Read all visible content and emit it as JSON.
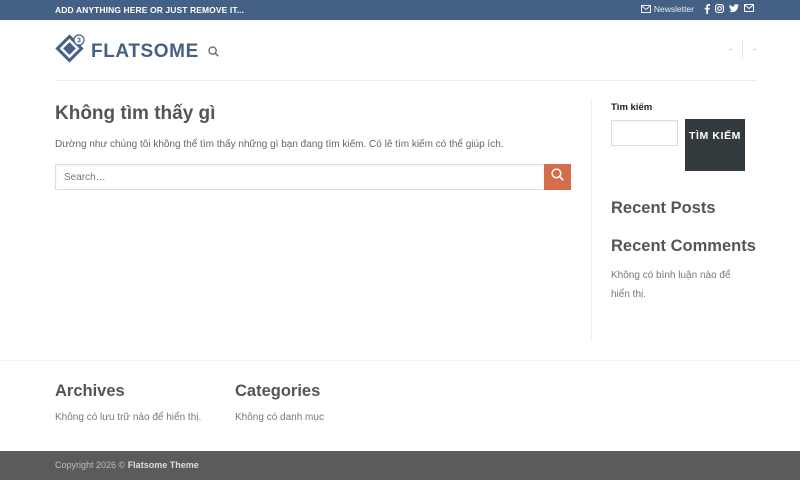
{
  "topbar": {
    "promo": "ADD ANYTHING HERE OR JUST REMOVE IT...",
    "newsletter_label": "Newsletter",
    "newsletter_icon": "envelope-icon",
    "social_icons": [
      "facebook-icon",
      "instagram-icon",
      "twitter-icon",
      "email-icon"
    ]
  },
  "header": {
    "logo_text": "FLATSOME",
    "logo_badge": "3",
    "search_icon": "search-icon",
    "nav_items": [
      "-",
      "-"
    ]
  },
  "main": {
    "title": "Không tìm thấy gì",
    "message": "Dường như chúng tôi không thể tìm thấy những gì bạn đang tìm kiếm. Có lẽ tìm kiếm có thể giúp ích.",
    "search": {
      "placeholder": "Search…",
      "value": "",
      "button_icon": "search-icon"
    }
  },
  "sidebar": {
    "search_label": "Tìm kiếm",
    "search_value": "",
    "search_button": "TÌM KIẾM",
    "recent_posts_title": "Recent Posts",
    "recent_comments_title": "Recent Comments",
    "recent_comments_empty": "Không có bình luận nào để hiển thị."
  },
  "footer_widgets": {
    "archives_title": "Archives",
    "archives_empty": "Không có lưu trữ nào để hiển thị.",
    "categories_title": "Categories",
    "categories_empty": "Không có danh mục"
  },
  "bottom_bar": {
    "copyright": "Copyright 2026 ©",
    "theme_name": "Flatsome Theme"
  },
  "colors": {
    "topbar_bg": "#446084",
    "accent": "#d26e4b",
    "button_dark": "#333a3e",
    "footer_bg": "#5b5b5b"
  }
}
